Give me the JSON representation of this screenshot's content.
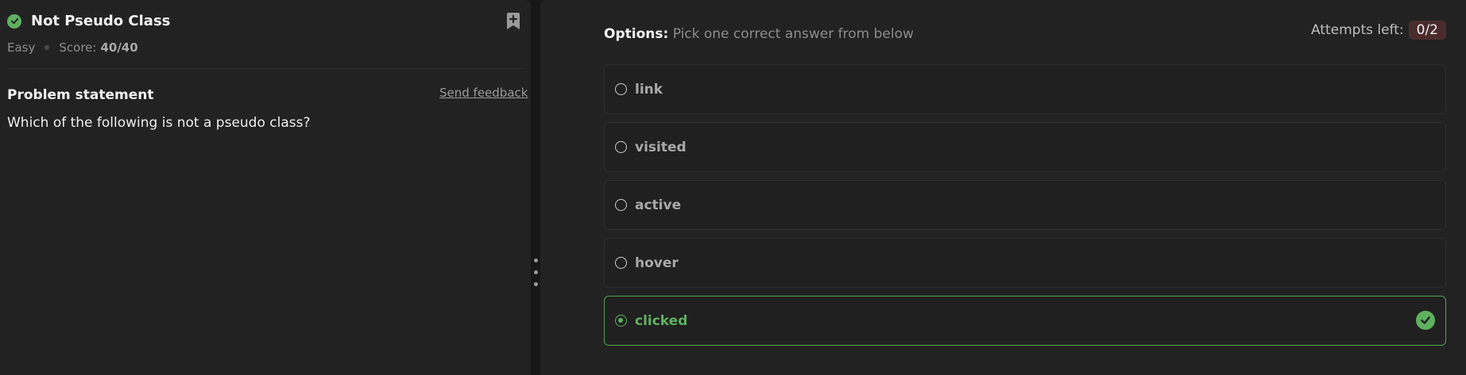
{
  "problem": {
    "title": "Not Pseudo Class",
    "difficulty": "Easy",
    "score_label": "Score:",
    "score_value": "40/40",
    "statement_heading": "Problem statement",
    "feedback_link": "Send feedback",
    "question": "Which of the following is not a pseudo class?"
  },
  "options_header": {
    "label": "Options:",
    "instruction": "Pick one correct answer from below"
  },
  "attempts": {
    "label": "Attempts left:",
    "value": "0/2"
  },
  "options": [
    {
      "label": "link",
      "selected": false
    },
    {
      "label": "visited",
      "selected": false
    },
    {
      "label": "active",
      "selected": false
    },
    {
      "label": "hover",
      "selected": false
    },
    {
      "label": "clicked",
      "selected": true,
      "correct": true
    }
  ],
  "colors": {
    "success": "#5fb15f",
    "panel": "#222222",
    "attempts_badge": "#4a2c2c"
  }
}
